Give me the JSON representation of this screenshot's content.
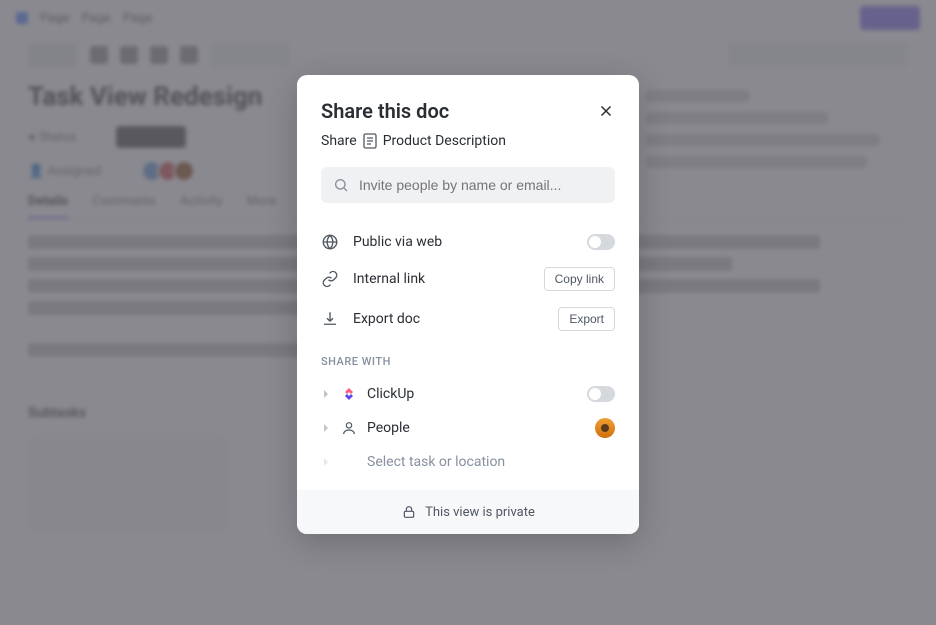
{
  "modal": {
    "title": "Share this doc",
    "breadcrumb_share": "Share",
    "breadcrumb_doc": "Product Description",
    "search_placeholder": "Invite people by name or email...",
    "options": {
      "public_label": "Public via web",
      "internal_label": "Internal link",
      "copy_link_btn": "Copy link",
      "export_label": "Export doc",
      "export_btn": "Export"
    },
    "section_label": "SHARE WITH",
    "share_with": {
      "clickup": "ClickUp",
      "people": "People",
      "select_task": "Select task or location"
    },
    "footer": "This view is private"
  },
  "background": {
    "title": "Task View Redesign",
    "tabs": [
      "Details",
      "Comments",
      "Activity",
      "More"
    ],
    "crumbs": [
      "Page",
      "Page",
      "Page"
    ]
  }
}
